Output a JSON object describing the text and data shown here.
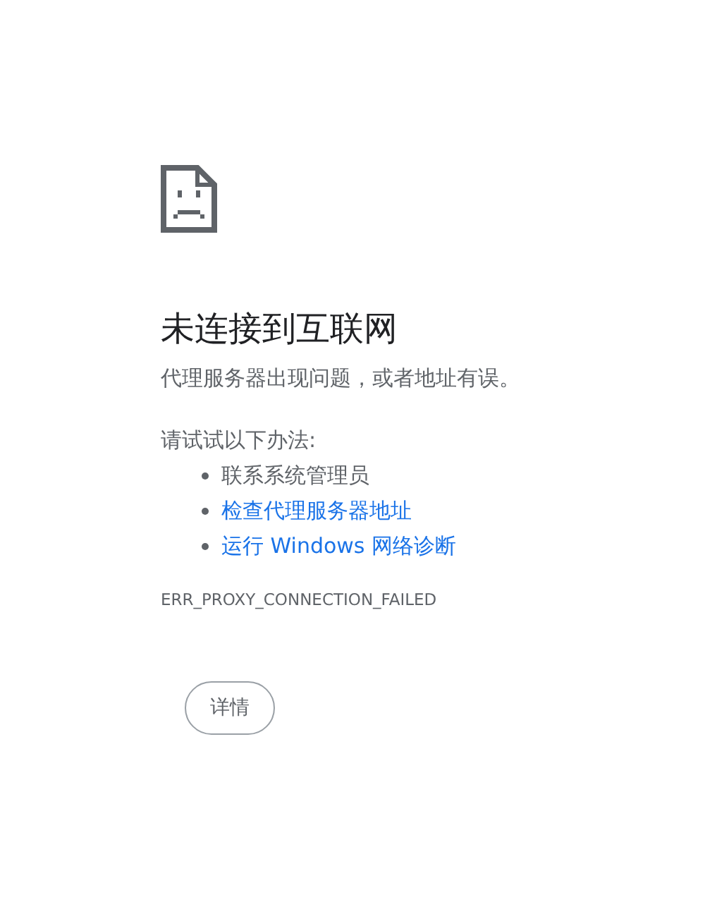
{
  "heading": "未连接到互联网",
  "message": "代理服务器出现问题，或者地址有误。",
  "suggestions_intro": "请试试以下办法:",
  "suggestions": [
    {
      "kind": "text",
      "label": "联系系统管理员"
    },
    {
      "kind": "link",
      "label": "检查代理服务器地址"
    },
    {
      "kind": "link",
      "label": "运行 Windows 网络诊断"
    }
  ],
  "error_code": "ERR_PROXY_CONNECTION_FAILED",
  "details_button": "详情"
}
